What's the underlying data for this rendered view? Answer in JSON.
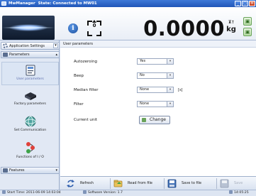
{
  "titlebar": {
    "app_name": "MwManager",
    "state_text": "State: Connected to MW01",
    "icon": "app-icon",
    "buttons": {
      "minimize": "_",
      "maximize": "□",
      "close": "✕"
    }
  },
  "header": {
    "weight_value": "0.0000",
    "unit_top": "⊼⊺",
    "unit": "kg",
    "info_icon": "i",
    "zero_icon": "zero-indicator-icon",
    "side_icons": [
      "window-icon",
      "window-icon"
    ]
  },
  "sidebar": {
    "app_settings_label": "Application Settings",
    "parameters_label": "Parameters",
    "features_label": "Features",
    "items": [
      {
        "label": "User parameters",
        "icon": "user-parameters-icon",
        "selected": true
      },
      {
        "label": "Factory parameters",
        "icon": "factory-parameters-icon",
        "selected": false
      },
      {
        "label": "Set Communication",
        "icon": "set-communication-icon",
        "selected": false
      },
      {
        "label": "Functions of I / O",
        "icon": "functions-io-icon",
        "selected": false
      }
    ]
  },
  "content": {
    "breadcrumb": "User parameters",
    "fields": [
      {
        "label": "Autozeroing",
        "value": "Yes"
      },
      {
        "label": "Beep",
        "value": "No"
      },
      {
        "label": "Median filter",
        "value": "None",
        "suffix": "[s]"
      },
      {
        "label": "Filter",
        "value": "None"
      }
    ],
    "current_unit_label": "Current unit",
    "change_button_label": "Change"
  },
  "toolbar": {
    "refresh_label": "Refresh",
    "read_label": "Read from file",
    "save_file_label": "Save to file",
    "save_label": "Save"
  },
  "statusbar": {
    "start_time": "Start Time: 2011-06-09 14:03:04",
    "software_version": "Software Version: 1.7",
    "clock": "14:05:25"
  },
  "colors": {
    "titlebar": "#2056b8",
    "accent_green": "#6aa35a",
    "selected_text": "#5a6cad"
  }
}
